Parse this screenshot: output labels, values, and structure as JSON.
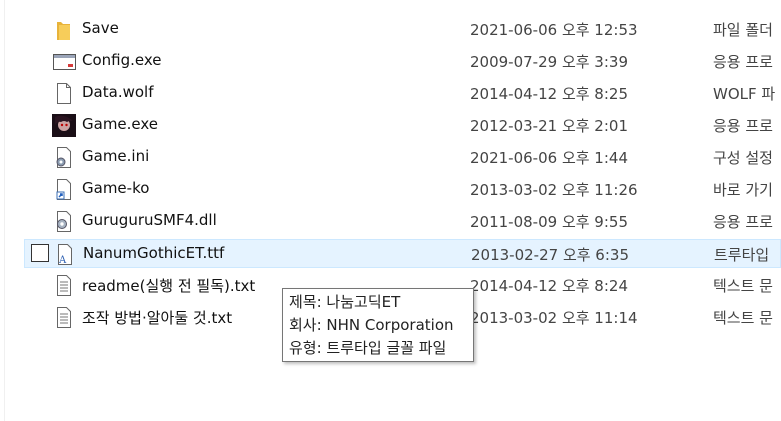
{
  "files": [
    {
      "name": "Save",
      "date": "2021-06-06 오후 12:53",
      "type": "파일 폴더",
      "icon": "folder-icon"
    },
    {
      "name": "Config.exe",
      "date": "2009-07-29 오후 3:39",
      "type": "응용 프로",
      "icon": "application-window-icon"
    },
    {
      "name": "Data.wolf",
      "date": "2014-04-12 오후 8:25",
      "type": "WOLF 파",
      "icon": "blank-file-icon"
    },
    {
      "name": "Game.exe",
      "date": "2012-03-21 오후 2:01",
      "type": "응용 프로",
      "icon": "game-character-icon"
    },
    {
      "name": "Game.ini",
      "date": "2021-06-06 오후 1:44",
      "type": "구성 설정",
      "icon": "settings-file-icon"
    },
    {
      "name": "Game-ko",
      "date": "2013-03-02 오후 11:26",
      "type": "바로 가기",
      "icon": "shortcut-file-icon"
    },
    {
      "name": "GuruguruSMF4.dll",
      "date": "2011-08-09 오후 9:55",
      "type": "응용 프로",
      "icon": "dll-gear-icon"
    },
    {
      "name": "NanumGothicET.ttf",
      "date": "2013-02-27 오후 6:35",
      "type": "트루타입",
      "icon": "font-file-icon"
    },
    {
      "name": "readme(실행 전 필독).txt",
      "date": "2014-04-12 오후 8:24",
      "type": "텍스트 문",
      "icon": "text-file-icon"
    },
    {
      "name": "조작 방법·알아둘 것.txt",
      "date": "2013-03-02 오후 11:14",
      "type": "텍스트 문",
      "icon": "text-file-icon"
    }
  ],
  "tooltip": {
    "title_line": "제목: 나눔고딕ET",
    "company_line": "회사: NHN Corporation",
    "type_line": "유형: 트루타입 글꼴 파일"
  },
  "colors": {
    "selection_bg": "#e5f3ff",
    "selection_border": "#cce8ff",
    "folder": "#f4c44e"
  }
}
